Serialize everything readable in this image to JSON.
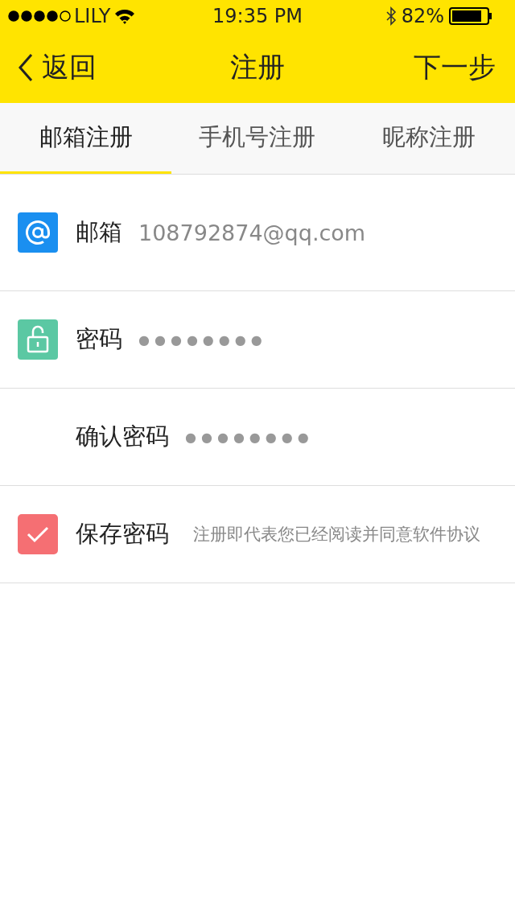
{
  "status_bar": {
    "carrier": "LILY",
    "time": "19:35  PM",
    "battery": "82%"
  },
  "nav": {
    "back": "返回",
    "title": "注册",
    "next": "下一步"
  },
  "tabs": [
    {
      "label": "邮箱注册",
      "selected": true
    },
    {
      "label": "手机号注册",
      "selected": false
    },
    {
      "label": "昵称注册",
      "selected": false
    }
  ],
  "form": [
    {
      "kind": "email",
      "label": "邮箱",
      "value": "108792874@qq.com"
    },
    {
      "kind": "password",
      "label": "密码",
      "value": "●●●●●●●●"
    },
    {
      "kind": "confirm",
      "label": "确认密码",
      "value": "●●●●●●●●"
    },
    {
      "kind": "save",
      "label": "保存密码",
      "checked": true,
      "note": "注册即代表您已经阅读并同意软件协议"
    }
  ]
}
